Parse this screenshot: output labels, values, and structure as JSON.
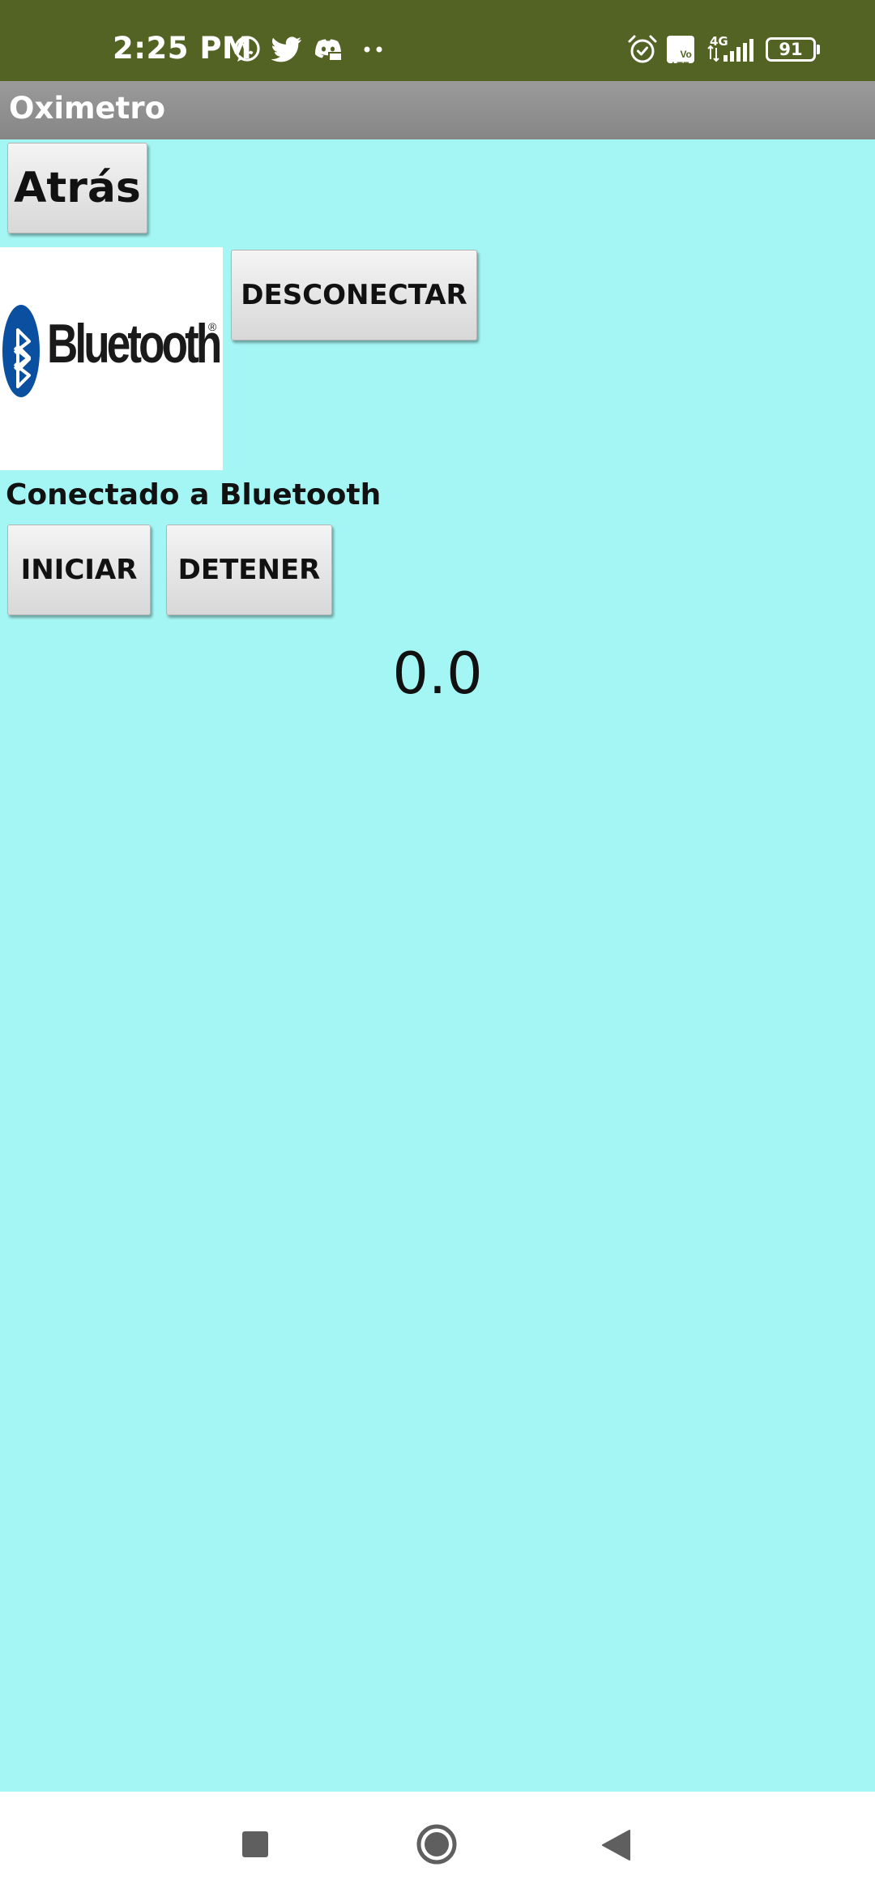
{
  "status_bar": {
    "time": "2:25 PM",
    "network": "4G",
    "volte": "Vo\nLTE",
    "battery": "91",
    "icons": [
      "whatsapp-icon",
      "twitter-icon",
      "discord-icon",
      "more-dots-icon",
      "alarm-icon",
      "volte-icon",
      "signal-icon",
      "battery-icon"
    ]
  },
  "app": {
    "title": "Oximetro"
  },
  "buttons": {
    "back": "Atrás",
    "disconnect": "DESCONECTAR",
    "start": "INICIAR",
    "stop": "DETENER"
  },
  "logo": {
    "text": "Bluetooth",
    "brand_color": "#0a4fa0"
  },
  "connection_status": "Conectado a Bluetooth",
  "reading_value": "0.0",
  "colors": {
    "status_bar": "#536324",
    "title_bar": "#8e8e8e",
    "background": "#a4f6f4",
    "nav_icons": "#5f5f5f"
  },
  "nav": [
    "recent-apps-icon",
    "home-icon",
    "back-icon"
  ]
}
